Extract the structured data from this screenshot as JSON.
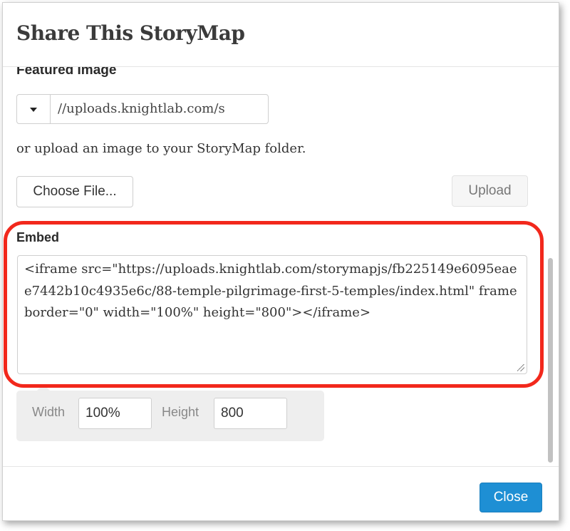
{
  "dialog": {
    "title": "Share This StoryMap"
  },
  "featured_image": {
    "label": "Featured Image",
    "url_value": "//uploads.knightlab.com/s",
    "upload_hint": "or upload an image to your StoryMap folder.",
    "choose_file_label": "Choose File...",
    "upload_label": "Upload"
  },
  "embed": {
    "label": "Embed",
    "code": "<iframe src=\"https://uploads.knightlab.com/storymapjs/fb225149e6095eaee7442b10c4935e6c/88-temple-pilgrimage-first-5-temples/index.html\" frameborder=\"0\" width=\"100%\" height=\"800\"></iframe>",
    "width_label": "Width",
    "width_value": "100%",
    "height_label": "Height",
    "height_value": "800"
  },
  "footer": {
    "close_label": "Close"
  },
  "colors": {
    "highlight": "#f2281c",
    "primary_button": "#1e8fd4"
  }
}
